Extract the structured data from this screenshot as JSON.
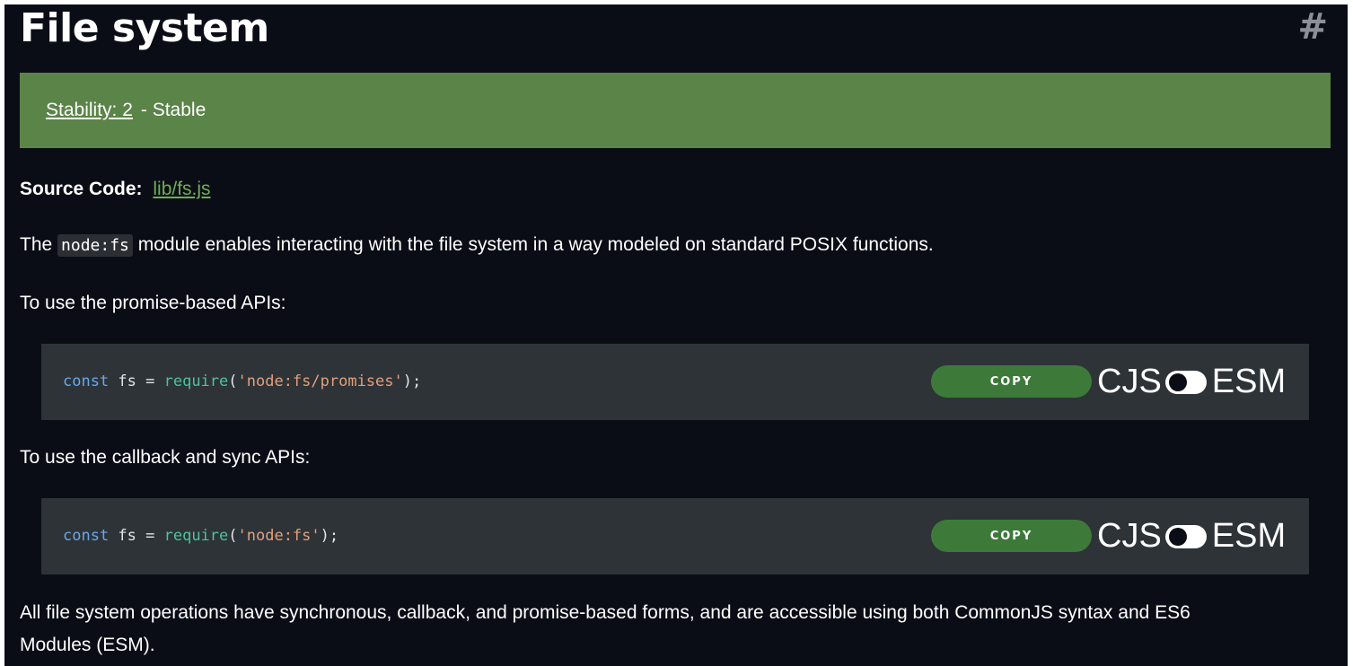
{
  "heading": {
    "title": "File system",
    "anchor": "#"
  },
  "stability": {
    "link_label": "Stability: 2",
    "text": "- Stable",
    "color": "#5b8449"
  },
  "source": {
    "label": "Source Code:",
    "link": "lib/fs.js"
  },
  "intro": {
    "before": "The",
    "code": "node:fs",
    "after": "module enables interacting with the file system in a way modeled on standard POSIX functions."
  },
  "promise_section": {
    "heading": "To use the promise-based APIs:",
    "code": {
      "kw": "const",
      "var": " fs = ",
      "fn": "require",
      "open": "(",
      "str": "'node:fs/promises'",
      "close": ");"
    }
  },
  "callback_section": {
    "heading": "To use the callback and sync APIs:",
    "code": {
      "kw": "const",
      "var": " fs = ",
      "fn": "require",
      "open": "(",
      "str": "'node:fs'",
      "close": ");"
    }
  },
  "code_controls": {
    "copy_label": "COPY",
    "toggle_left": "CJS",
    "toggle_right": "ESM"
  },
  "summary": {
    "line1": "All file system operations have synchronous, callback, and promise-based forms, and are accessible using both CommonJS syntax and ES6",
    "line2": "Modules (ESM)."
  }
}
